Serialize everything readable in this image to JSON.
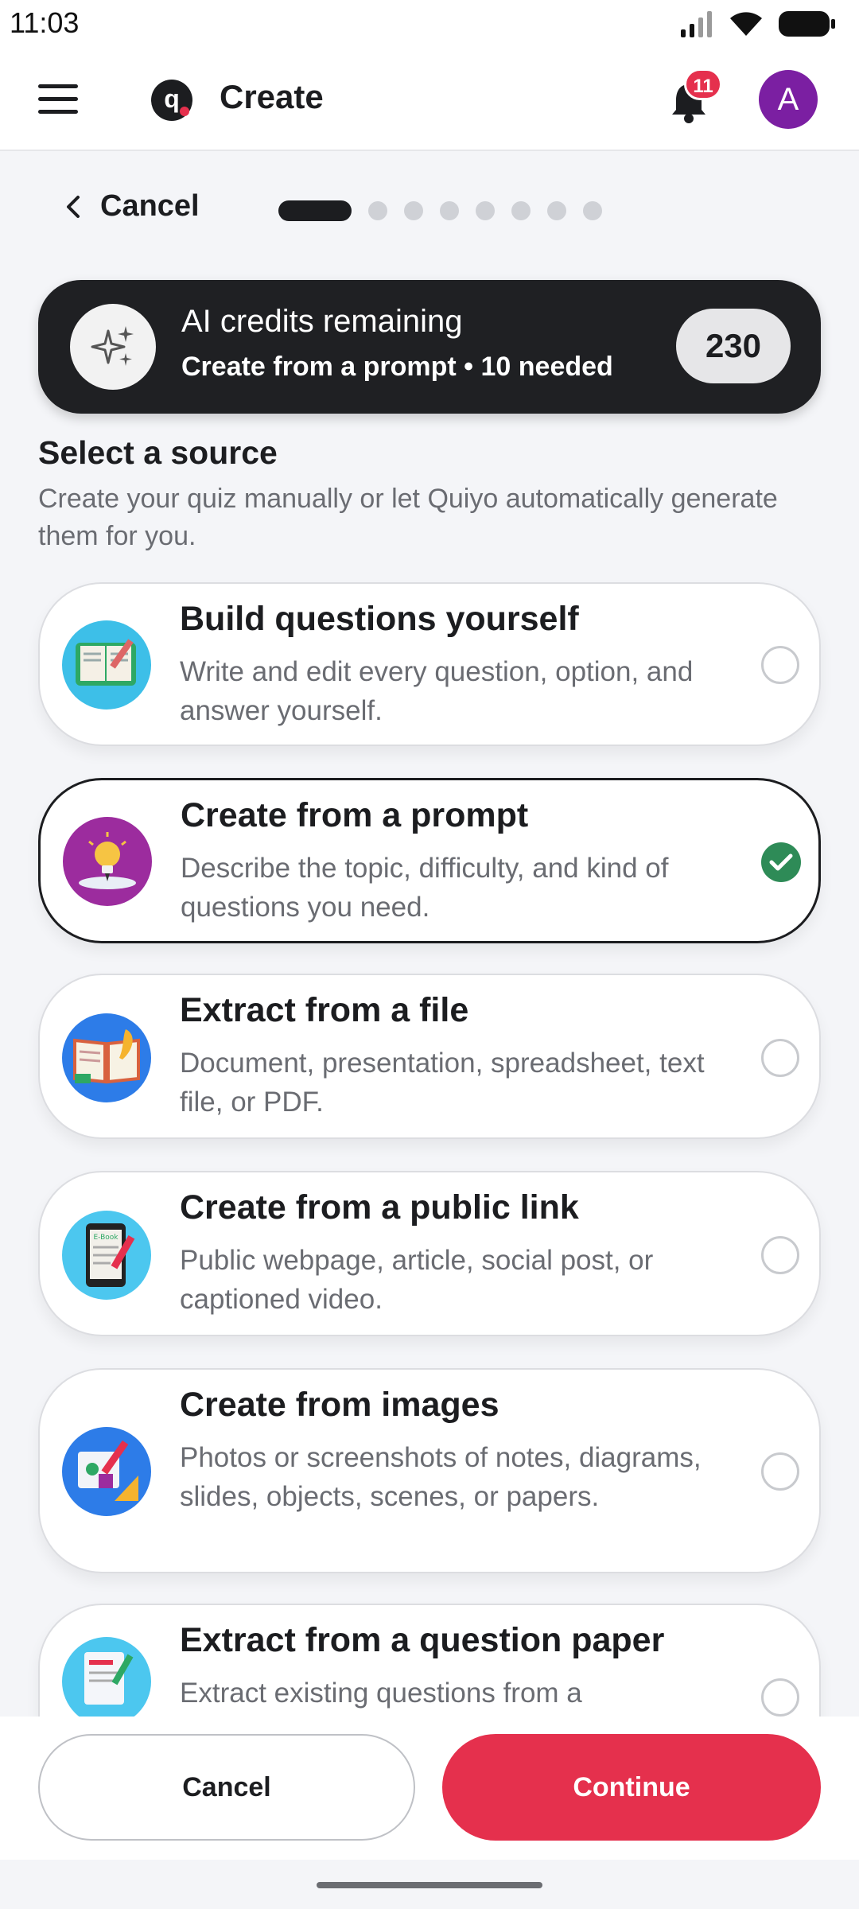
{
  "status_bar": {
    "time": "11:03"
  },
  "header": {
    "title": "Create",
    "notification_count": "11",
    "avatar_initial": "A"
  },
  "stepper": {
    "cancel_label": "Cancel",
    "total_steps": 8,
    "current_step": 1
  },
  "credits": {
    "title": "AI credits remaining",
    "subtitle": "Create from a prompt • 10 needed",
    "remaining": "230"
  },
  "source": {
    "title": "Select a source",
    "description": "Create your quiz manually or let Quiyo automatically generate them for you."
  },
  "options": [
    {
      "title": "Build questions yourself",
      "description": "Write and edit every question, option, and answer yourself.",
      "selected": false,
      "icon": "open-book-pencil-icon"
    },
    {
      "title": "Create from a prompt",
      "description": "Describe the topic, difficulty, and kind of questions you need.",
      "selected": true,
      "icon": "lightbulb-icon"
    },
    {
      "title": "Extract from a file",
      "description": "Document, presentation, spreadsheet, text file, or PDF.",
      "selected": false,
      "icon": "book-quill-icon"
    },
    {
      "title": "Create from a public link",
      "description": "Public webpage, article, social post, or captioned video.",
      "selected": false,
      "icon": "ebook-tablet-icon",
      "icon_text": "E-Book"
    },
    {
      "title": "Create from images",
      "description": "Photos or screenshots of notes, diagrams, slides, objects, scenes, or papers.",
      "selected": false,
      "icon": "geometry-drawing-icon"
    },
    {
      "title": "Extract from a question paper",
      "description": "Extract existing questions from a",
      "selected": false,
      "icon": "question-paper-icon"
    }
  ],
  "footer": {
    "cancel_label": "Cancel",
    "continue_label": "Continue"
  },
  "colors": {
    "accent": "#e5304d",
    "dark": "#1f2023",
    "check": "#2e8b57",
    "avatar": "#7b1fa2"
  }
}
